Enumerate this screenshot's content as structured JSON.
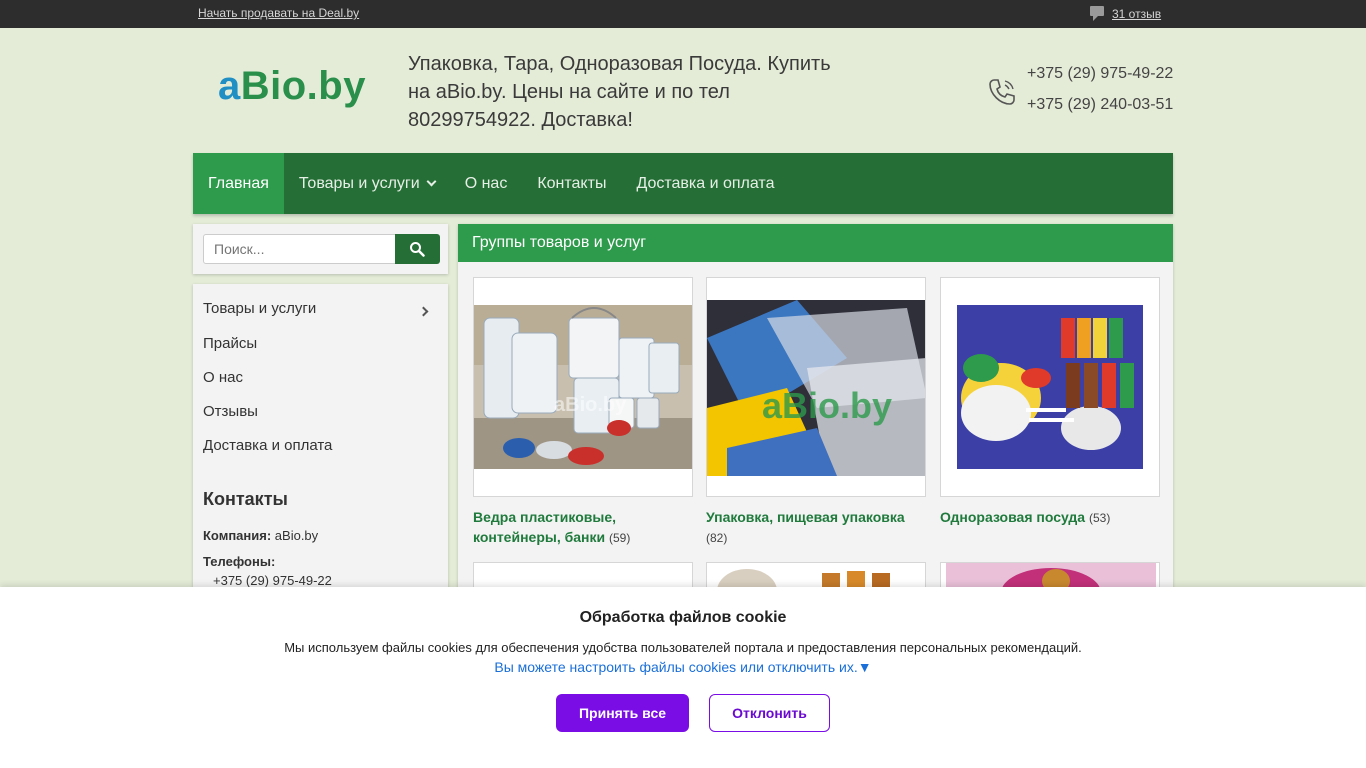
{
  "topbar": {
    "sell_link": "Начать продавать на Deal.by",
    "reviews_link": "31 отзыв",
    "reviews_icon": "speech-bubble-icon"
  },
  "header": {
    "logo_a": "a",
    "logo_bio": "Bio.by",
    "tagline": "Упаковка, Тара, Одноразовая Посуда. Купить на aBio.by. Цены на сайте и по тел 80299754922. Доставка!",
    "phone_icon": "phone-icon",
    "phones": [
      "+375 (29) 975-49-22",
      "+375 (29) 240-03-51"
    ]
  },
  "nav": {
    "items": [
      {
        "label": "Главная"
      },
      {
        "label": "Товары и услуги"
      },
      {
        "label": "О нас"
      },
      {
        "label": "Контакты"
      },
      {
        "label": "Доставка и оплата"
      }
    ]
  },
  "search": {
    "placeholder": "Поиск...",
    "button_icon": "search-icon"
  },
  "sidebar": {
    "menu": [
      {
        "label": "Товары и услуги"
      },
      {
        "label": "Прайсы"
      },
      {
        "label": "О нас"
      },
      {
        "label": "Отзывы"
      },
      {
        "label": "Доставка и оплата"
      }
    ],
    "contacts_title": "Контакты",
    "company_label": "Компания:",
    "company_value": "aBio.by",
    "phones_label": "Телефоны:",
    "phone_value": "+375 (29) 975-49-22"
  },
  "main": {
    "title": "Группы товаров и услуг",
    "groups": [
      {
        "name": "Ведра пластиковые, контейнеры, банки",
        "count": "(59)"
      },
      {
        "name": "Упаковка, пищевая упаковка",
        "count": "(82)"
      },
      {
        "name": "Одноразовая посуда",
        "count": "(53)"
      }
    ],
    "watermark": "aBio.by"
  },
  "cookie": {
    "title": "Обработка файлов cookie",
    "text": "Мы используем файлы cookies для обеспечения удобства пользователей портала и предоставления персональных рекомендаций.",
    "settings_link": "Вы можете настроить файлы cookies или отключить их.▼",
    "accept_label": "Принять все",
    "decline_label": "Отклонить"
  },
  "colors": {
    "nav_bg": "#256e36",
    "accent": "#2e9a4c",
    "cookie_button": "#7a0ce6",
    "link": "#1a6fd8"
  }
}
